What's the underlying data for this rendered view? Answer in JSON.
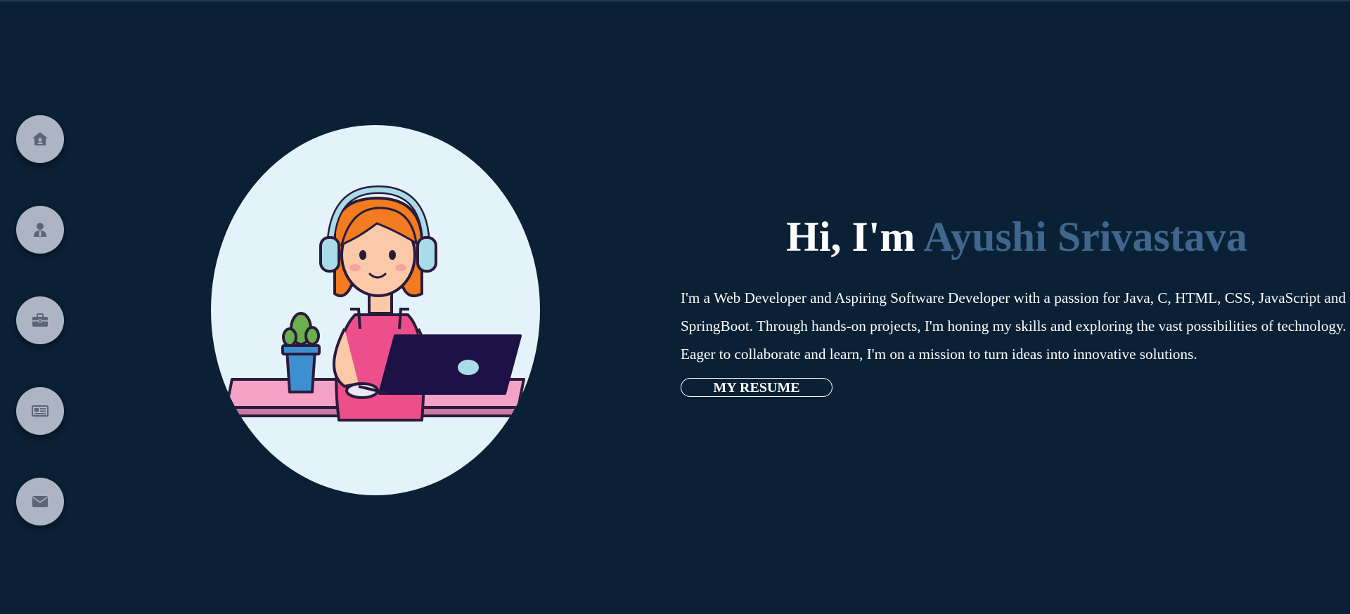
{
  "hero": {
    "greeting": "Hi, I'm",
    "name": "Ayushi Srivastava",
    "bio": "I'm a Web Developer and Aspiring Software Developer with a passion for Java, C, HTML, CSS, JavaScript and SpringBoot. Through hands-on projects, I'm honing my skills and exploring the vast possibilities of technology. Eager to collaborate and learn, I'm on a mission to turn ideas into innovative solutions.",
    "resume_label": "MY RESUME"
  },
  "sidenav": {
    "items": [
      {
        "icon": "home-icon"
      },
      {
        "icon": "user-tie-icon"
      },
      {
        "icon": "briefcase-icon"
      },
      {
        "icon": "newspaper-icon"
      },
      {
        "icon": "envelope-icon"
      }
    ]
  },
  "colors": {
    "background": "#0a2035",
    "accent": "#41668d",
    "nav_button": "#adb5c4",
    "nav_icon": "#5b6574",
    "avatar_bg": "#e3f3f9"
  }
}
